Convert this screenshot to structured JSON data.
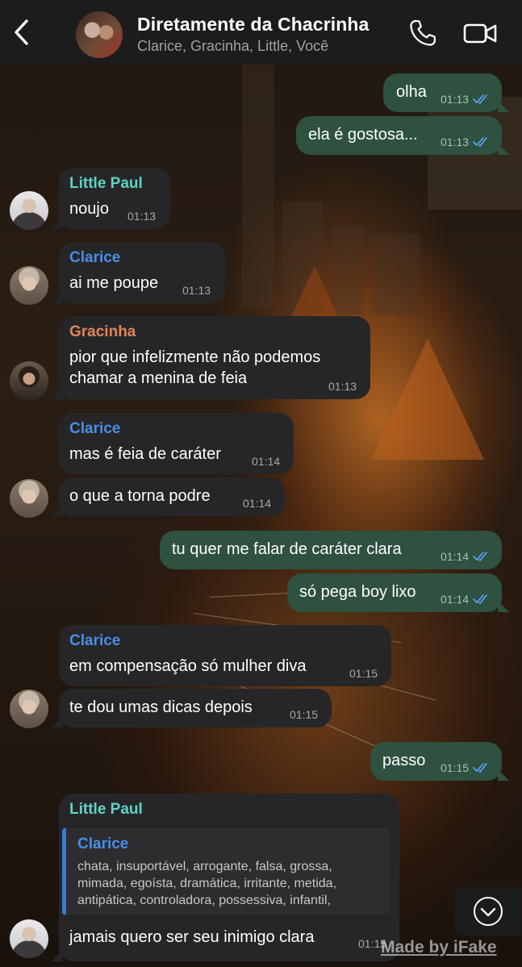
{
  "header": {
    "title": "Diretamente da Chacrinha",
    "subtitle": "Clarice, Gracinha, Little, Você",
    "back_icon": "chevron-left-icon",
    "call_icon": "phone-icon",
    "video_icon": "video-camera-icon"
  },
  "colors": {
    "outgoing_bubble": "#2e5140",
    "incoming_bubble": "#262628",
    "little_paul": "#5fd3c4",
    "clarice": "#4a8ee6",
    "gracinha": "#e0845a",
    "read_ticks": "#5aa8ff"
  },
  "messages": [
    {
      "text": "olha",
      "time": "01:13"
    },
    {
      "text": "ela é gostosa...",
      "time": "01:13"
    },
    {
      "sender": "Little Paul",
      "text": "noujo",
      "time": "01:13"
    },
    {
      "sender": "Clarice",
      "text": "ai me poupe",
      "time": "01:13"
    },
    {
      "sender": "Gracinha",
      "text": "pior que infelizmente não podemos",
      "text2": "chamar a menina de feia",
      "time": "01:13"
    },
    {
      "sender": "Clarice",
      "text": "mas é feia de caráter",
      "time": "01:14"
    },
    {
      "text": "o que a torna podre",
      "time": "01:14"
    },
    {
      "text": "tu quer me falar de caráter clara",
      "time": "01:14"
    },
    {
      "text": "só pega boy lixo",
      "time": "01:14"
    },
    {
      "sender": "Clarice",
      "text": "em compensação só mulher diva",
      "time": "01:15"
    },
    {
      "text": "te dou umas dicas depois",
      "time": "01:15"
    },
    {
      "text": "passo",
      "time": "01:15"
    },
    {
      "sender": "Little Paul",
      "quote_sender": "Clarice",
      "quote_text": "chata, insuportável, arrogante, falsa, grossa,\nmimada, egoísta, dramática, irritante, metida,\nantipática, controladora, possessiva, infantil,",
      "text": "jamais quero ser seu inimigo clara",
      "time": "01:15"
    }
  ],
  "scroll_down_icon": "chevron-down-circle-icon",
  "watermark": "Made by iFake"
}
